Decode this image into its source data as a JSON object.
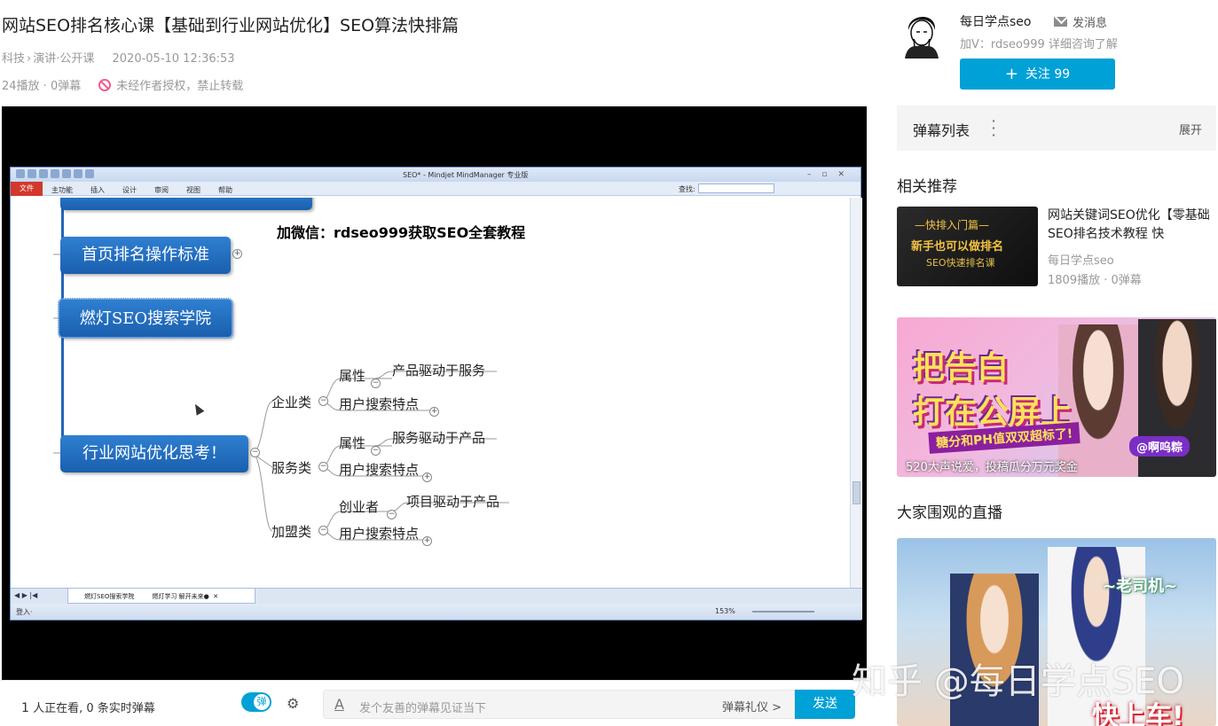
{
  "video": {
    "title": "网站SEO排名核心课【基础到行业网站优化】SEO算法快排篇",
    "category": "科技",
    "subcategory": "演讲·公开课",
    "date": "2020-05-10 12:36:53",
    "stats": "24播放 · 0弹幕",
    "copyright": "未经作者授权，禁止转载"
  },
  "mindmanager": {
    "window_title": "SEO* - Mindjet MindManager 专业版",
    "menu": [
      "主功能",
      "插入",
      "设计",
      "审阅",
      "视图",
      "帮助"
    ],
    "file_label": "文件",
    "find_label": "查找:",
    "banner": "加微信：rdseo999获取SEO全套教程",
    "node1": "首页排名操作标准",
    "node2": "燃灯SEO搜索学院",
    "node3": "行业网站优化思考！",
    "branch_a": "企业类",
    "branch_b": "服务类",
    "branch_c": "加盟类",
    "a_attr": "属性",
    "a_attr_val": "产品驱动于服务",
    "a_user": "用户搜索特点",
    "b_attr": "属性",
    "b_attr_val": "服务驱动于产品",
    "b_user": "用户搜索特点",
    "c_attr": "创业者",
    "c_attr_val": "项目驱动于产品",
    "c_user": "用户搜索特点",
    "tab_label": "燃灯SEO搜索学院",
    "tab_label2": "燃灯学习  解开未来●",
    "status_login": "登入·",
    "zoom": "153%"
  },
  "danmaku_bar": {
    "viewers_count": "1",
    "viewers_text": "人正在看,",
    "realtime": "0 条实时弹幕",
    "toggle_label": "弹",
    "input_placeholder": "发个友善的弹幕见证当下",
    "etiquette": "弹幕礼仪 >",
    "send": "发送"
  },
  "uploader": {
    "name": "每日学点seo",
    "message": "发消息",
    "desc": "加V：rdseo999 详细咨询了解",
    "follow": "关注 99"
  },
  "danmaku_list": {
    "title": "弹幕列表",
    "expand": "展开"
  },
  "related": {
    "heading": "相关推荐",
    "items": [
      {
        "title": "网站关键词SEO优化【零基础SEO排名技术教程 快",
        "uploader": "每日学点seo",
        "stats": "1809播放 · 0弹幕",
        "thumb_line1": "—快排入门篇—",
        "thumb_line2": "新手也可以做排名",
        "thumb_line3": "SEO快速排名课"
      }
    ]
  },
  "ad": {
    "line1": "把告白",
    "line2": "打在公屏上",
    "band": "糖分和PH值双双超标了!",
    "tag": "@啊呜粽",
    "caption": "520大声说爱，投稿瓜分万元奖金"
  },
  "live": {
    "heading": "大家围观的直播",
    "top_text": "~老司机~",
    "bottom_text": "快上车!"
  },
  "watermark": "知乎 @每日学点SEO",
  "colors": {
    "accent": "#00a1d6",
    "node_blue": "#2366b6",
    "warn_pink": "#f25d8e"
  }
}
